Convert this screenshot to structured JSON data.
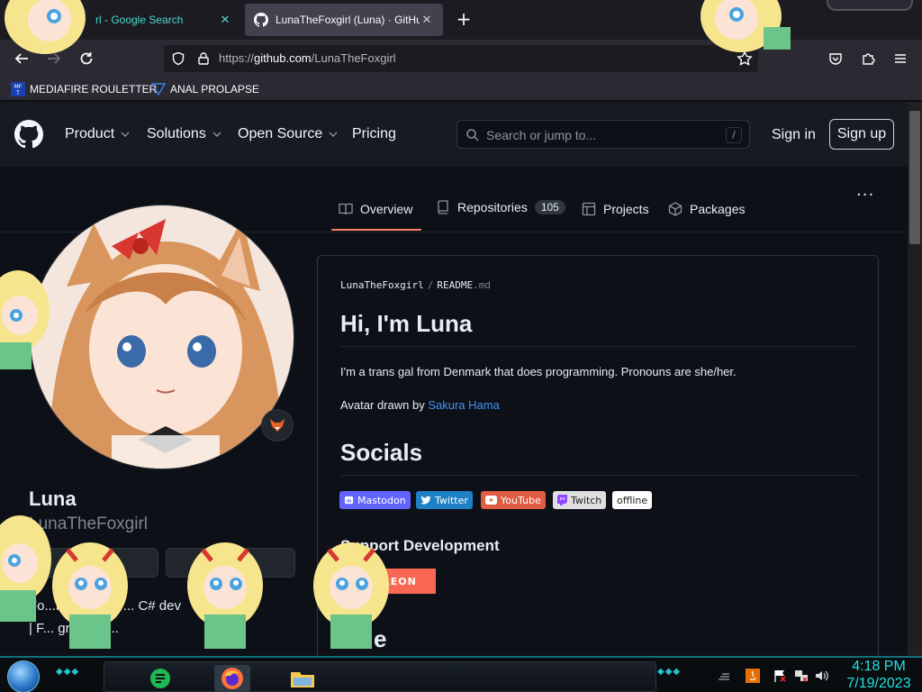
{
  "browser": {
    "tabs": [
      {
        "title": "rl - Google Search",
        "close": "✕",
        "active": false
      },
      {
        "title": "LunaTheFoxgirl (Luna) · GitHub",
        "close": "✕",
        "active": true
      }
    ],
    "new_tab": "+",
    "url_prefix": "https://",
    "url_host": "github.com",
    "url_path": "/LunaTheFoxgirl",
    "bookmarks": [
      {
        "label": "MEDIAFIRE ROULETTER",
        "icon": "mediafire-icon"
      },
      {
        "label": "ANAL PROLAPSE",
        "icon": "bookmark-icon"
      }
    ]
  },
  "gh_header": {
    "nav": [
      "Product",
      "Solutions",
      "Open Source",
      "Pricing"
    ],
    "search_placeholder": "Search or jump to...",
    "search_key": "/",
    "signin": "Sign in",
    "signup": "Sign up"
  },
  "profile_tabs": {
    "overview": "Overview",
    "repositories": "Repositories",
    "repo_count": "105",
    "projects": "Projects",
    "packages": "Packages",
    "more": "···"
  },
  "profile": {
    "name": "Luna",
    "login": "LunaTheFoxgirl",
    "bio_line1": "Fo...n | she/her ... C# dev",
    "bio_line2": "| F... great | V..."
  },
  "readme": {
    "owner": "LunaTheFoxgirl",
    "sep": "/",
    "file": "README",
    "ext": ".md",
    "h1": "Hi, I'm Luna",
    "intro": "I'm a trans gal from Denmark that does programming. Pronouns are she/her.",
    "avatar_prefix": "Avatar drawn by ",
    "avatar_artist": "Sakura Hama",
    "h2_socials": "Socials",
    "badges": [
      {
        "label": "Mastodon",
        "color": "#6364ff",
        "icon": "mastodon-icon"
      },
      {
        "label": "Twitter",
        "color": "#1d9bf0",
        "icon": "twitter-icon"
      },
      {
        "label": "YouTube",
        "color": "#e05d44",
        "icon": "youtube-icon"
      },
      {
        "label": "Twitch",
        "color": "#dfdfdf",
        "icon": "twitch-icon"
      },
      {
        "label": "offline",
        "color": "#ffffff",
        "icon": ""
      }
    ],
    "h3_support": "Support Development",
    "patreon": "PATREON",
    "partial_heading": "e"
  },
  "taskbar": {
    "time": "4:18 PM",
    "date": "7/19/2023"
  },
  "colors": {
    "accent": "#f78166",
    "link": "#4493f8",
    "bg": "#0d1117"
  }
}
